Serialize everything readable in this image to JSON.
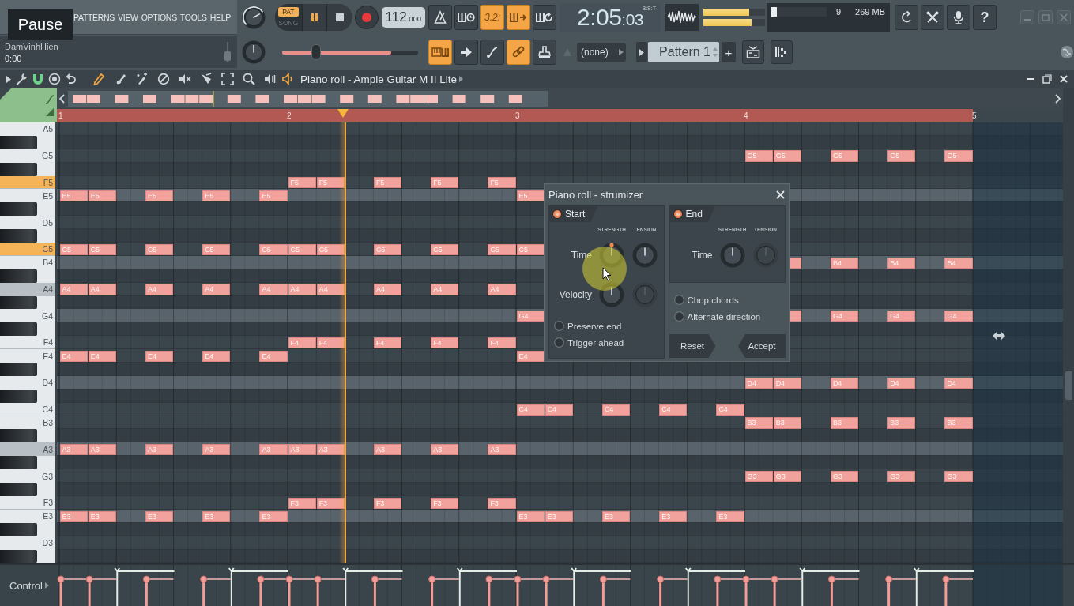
{
  "menu": {
    "items": [
      "PATTERNS",
      "VIEW",
      "OPTIONS",
      "TOOLS",
      "HELP"
    ]
  },
  "tooltip": "Pause",
  "hint_panel": {
    "title": "DamVinhHien",
    "time": "0:00"
  },
  "transport": {
    "modes": [
      {
        "label": "PAT",
        "selected": true
      },
      {
        "label": "SONG",
        "selected": false
      }
    ],
    "playing": true,
    "tempo": {
      "whole": "112",
      "fraction": ".000"
    }
  },
  "position_slider": {
    "level": 0.25
  },
  "position_bar": {
    "level": 0.8
  },
  "toolbar_top": [
    {
      "on": false
    },
    {
      "on": false
    },
    {
      "on": true,
      "text": "3.2:"
    },
    {
      "on": true
    },
    {
      "on": false
    }
  ],
  "toolbar_bottom": [
    {
      "on": true
    },
    {
      "on": false
    },
    {
      "on": false
    },
    {
      "on": true
    },
    {
      "on": false
    }
  ],
  "song_time": {
    "value": "2:05",
    "ticks": ":03",
    "format": "B:S:T"
  },
  "output_meters": [
    {
      "level": 0.74
    },
    {
      "level": 0.78
    }
  ],
  "cpu": {
    "level": 0.1,
    "polyphony": "9",
    "memory": "269 MB"
  },
  "help_button": "?",
  "channel_selector": {
    "value": "(none)"
  },
  "pattern_selector": {
    "value": "Pattern 1",
    "add": "+"
  },
  "piano_roll": {
    "title": "Piano roll - Ample Guitar M II Lite",
    "tools": [
      {
        "selected": true
      },
      {
        "selected": false
      },
      {
        "selected": false
      },
      {
        "selected": false
      },
      {
        "selected": false
      },
      {
        "selected": false
      },
      {
        "selected": false
      },
      {
        "selected": false
      },
      {
        "selected": false
      }
    ],
    "timeline": {
      "bars": [
        "1",
        "2",
        "3",
        "4",
        "5"
      ],
      "playhead": {
        "level": 0.3125
      }
    },
    "rows": [
      {
        "kind": "white",
        "key": "A5",
        "pressed": false,
        "shaded": false,
        "highlighted": false
      },
      {
        "kind": "black",
        "pressed": false,
        "shaded": false,
        "highlighted": false
      },
      {
        "kind": "white",
        "key": "G5",
        "pressed": false,
        "shaded": false,
        "highlighted": false,
        "bars": [
          {
            "kind": "empty"
          },
          {
            "kind": "empty"
          },
          {
            "kind": "empty"
          },
          {
            "kind": "notes",
            "slots": [
              {
                "kind": "note",
                "label": "G5"
              },
              {
                "kind": "note",
                "label": "G5"
              },
              {
                "kind": "rest"
              },
              {
                "kind": "note",
                "label": "G5"
              },
              {
                "kind": "rest"
              },
              {
                "kind": "note",
                "label": "G5"
              },
              {
                "kind": "rest"
              },
              {
                "kind": "note",
                "label": "G5"
              }
            ]
          }
        ]
      },
      {
        "kind": "black",
        "pressed": false,
        "shaded": false,
        "highlighted": false
      },
      {
        "kind": "white",
        "key": "F5",
        "pressed": true,
        "shaded": false,
        "highlighted": false,
        "bars": [
          {
            "kind": "empty"
          },
          {
            "kind": "notes",
            "slots": [
              {
                "kind": "note",
                "label": "F5"
              },
              {
                "kind": "note",
                "label": "F5"
              },
              {
                "kind": "rest"
              },
              {
                "kind": "note",
                "label": "F5"
              },
              {
                "kind": "rest"
              },
              {
                "kind": "note",
                "label": "F5"
              },
              {
                "kind": "rest"
              },
              {
                "kind": "note",
                "label": "F5"
              }
            ]
          }
        ]
      },
      {
        "kind": "white",
        "key": "E5",
        "pressed": false,
        "shaded": false,
        "highlighted": true,
        "bars": [
          {
            "kind": "notes",
            "slots": [
              {
                "kind": "note",
                "label": "E5"
              },
              {
                "kind": "note",
                "label": "E5"
              },
              {
                "kind": "rest"
              },
              {
                "kind": "note",
                "label": "E5"
              },
              {
                "kind": "rest"
              },
              {
                "kind": "note",
                "label": "E5"
              },
              {
                "kind": "rest"
              },
              {
                "kind": "note",
                "label": "E5"
              }
            ]
          },
          {
            "kind": "empty"
          },
          {
            "kind": "notes",
            "slots": [
              {
                "kind": "note",
                "label": "E5"
              }
            ]
          }
        ]
      },
      {
        "kind": "black",
        "pressed": false,
        "shaded": false,
        "highlighted": false
      },
      {
        "kind": "white",
        "key": "D5",
        "pressed": false,
        "shaded": false,
        "highlighted": false
      },
      {
        "kind": "black",
        "pressed": false,
        "shaded": false,
        "highlighted": false
      },
      {
        "kind": "white",
        "key": "C5",
        "pressed": true,
        "shaded": false,
        "highlighted": false,
        "bars": [
          {
            "kind": "notes",
            "slots": [
              {
                "kind": "note",
                "label": "C5"
              },
              {
                "kind": "note",
                "label": "C5"
              },
              {
                "kind": "rest"
              },
              {
                "kind": "note",
                "label": "C5"
              },
              {
                "kind": "rest"
              },
              {
                "kind": "note",
                "label": "C5"
              },
              {
                "kind": "rest"
              },
              {
                "kind": "note",
                "label": "C5"
              }
            ]
          },
          {
            "kind": "notes",
            "slots": [
              {
                "kind": "note",
                "label": "C5"
              },
              {
                "kind": "note",
                "label": "C5"
              },
              {
                "kind": "rest"
              },
              {
                "kind": "note",
                "label": "C5"
              },
              {
                "kind": "rest"
              },
              {
                "kind": "note",
                "label": "C5"
              },
              {
                "kind": "rest"
              },
              {
                "kind": "note",
                "label": "C5"
              }
            ]
          },
          {
            "kind": "notes",
            "slots": [
              {
                "kind": "note",
                "label": "C5"
              }
            ]
          }
        ]
      },
      {
        "kind": "white",
        "key": "B4",
        "pressed": false,
        "shaded": false,
        "highlighted": true,
        "bars": [
          {
            "kind": "empty"
          },
          {
            "kind": "empty"
          },
          {
            "kind": "empty"
          },
          {
            "kind": "notes",
            "slots": [
              {
                "kind": "rest"
              },
              {
                "kind": "note"
              },
              {
                "kind": "rest"
              },
              {
                "kind": "note",
                "label": "B4"
              },
              {
                "kind": "rest"
              },
              {
                "kind": "note",
                "label": "B4"
              },
              {
                "kind": "rest"
              },
              {
                "kind": "note",
                "label": "B4"
              }
            ]
          }
        ]
      },
      {
        "kind": "black",
        "pressed": false,
        "shaded": false,
        "highlighted": false
      },
      {
        "kind": "white",
        "key": "A4",
        "pressed": false,
        "shaded": true,
        "highlighted": false,
        "bars": [
          {
            "kind": "notes",
            "slots": [
              {
                "kind": "note",
                "label": "A4"
              },
              {
                "kind": "note",
                "label": "A4"
              },
              {
                "kind": "rest"
              },
              {
                "kind": "note",
                "label": "A4"
              },
              {
                "kind": "rest"
              },
              {
                "kind": "note",
                "label": "A4"
              },
              {
                "kind": "rest"
              },
              {
                "kind": "note",
                "label": "A4"
              }
            ]
          },
          {
            "kind": "notes",
            "slots": [
              {
                "kind": "note",
                "label": "A4"
              },
              {
                "kind": "note",
                "label": "A4"
              },
              {
                "kind": "rest"
              },
              {
                "kind": "note",
                "label": "A4"
              },
              {
                "kind": "rest"
              },
              {
                "kind": "note",
                "label": "A4"
              },
              {
                "kind": "rest"
              },
              {
                "kind": "note",
                "label": "A4"
              }
            ]
          }
        ]
      },
      {
        "kind": "black",
        "pressed": false,
        "shaded": false,
        "highlighted": false
      },
      {
        "kind": "white",
        "key": "G4",
        "pressed": false,
        "shaded": false,
        "highlighted": true,
        "bars": [
          {
            "kind": "empty"
          },
          {
            "kind": "empty"
          },
          {
            "kind": "notes",
            "slots": [
              {
                "kind": "note",
                "label": "G4"
              }
            ]
          },
          {
            "kind": "notes",
            "slots": [
              {
                "kind": "rest"
              },
              {
                "kind": "note"
              },
              {
                "kind": "rest"
              },
              {
                "kind": "note",
                "label": "G4"
              },
              {
                "kind": "rest"
              },
              {
                "kind": "note",
                "label": "G4"
              },
              {
                "kind": "rest"
              },
              {
                "kind": "note",
                "label": "G4"
              }
            ]
          }
        ]
      },
      {
        "kind": "black",
        "pressed": false,
        "shaded": false,
        "highlighted": false
      },
      {
        "kind": "white",
        "key": "F4",
        "pressed": false,
        "shaded": false,
        "highlighted": false,
        "bars": [
          {
            "kind": "empty"
          },
          {
            "kind": "notes",
            "slots": [
              {
                "kind": "note",
                "label": "F4"
              },
              {
                "kind": "note",
                "label": "F4"
              },
              {
                "kind": "rest"
              },
              {
                "kind": "note",
                "label": "F4"
              },
              {
                "kind": "rest"
              },
              {
                "kind": "note",
                "label": "F4"
              },
              {
                "kind": "rest"
              },
              {
                "kind": "note",
                "label": "F4"
              }
            ]
          }
        ]
      },
      {
        "kind": "white",
        "key": "E4",
        "pressed": false,
        "shaded": false,
        "highlighted": false,
        "bars": [
          {
            "kind": "notes",
            "slots": [
              {
                "kind": "note",
                "label": "E4"
              },
              {
                "kind": "note",
                "label": "E4"
              },
              {
                "kind": "rest"
              },
              {
                "kind": "note",
                "label": "E4"
              },
              {
                "kind": "rest"
              },
              {
                "kind": "note",
                "label": "E4"
              },
              {
                "kind": "rest"
              },
              {
                "kind": "note",
                "label": "E4"
              }
            ]
          },
          {
            "kind": "empty"
          },
          {
            "kind": "notes",
            "slots": [
              {
                "kind": "note",
                "label": "E4"
              }
            ]
          }
        ]
      },
      {
        "kind": "black",
        "pressed": false,
        "shaded": false,
        "highlighted": false
      },
      {
        "kind": "white",
        "key": "D4",
        "pressed": false,
        "shaded": false,
        "highlighted": true,
        "bars": [
          {
            "kind": "empty"
          },
          {
            "kind": "empty"
          },
          {
            "kind": "empty"
          },
          {
            "kind": "notes",
            "slots": [
              {
                "kind": "note",
                "label": "D4"
              },
              {
                "kind": "note",
                "label": "D4"
              },
              {
                "kind": "rest"
              },
              {
                "kind": "note",
                "label": "D4"
              },
              {
                "kind": "rest"
              },
              {
                "kind": "note",
                "label": "D4"
              },
              {
                "kind": "rest"
              },
              {
                "kind": "note",
                "label": "D4"
              }
            ]
          }
        ]
      },
      {
        "kind": "black",
        "pressed": false,
        "shaded": false,
        "highlighted": false
      },
      {
        "kind": "white",
        "key": "C4",
        "pressed": false,
        "shaded": false,
        "highlighted": false,
        "bars": [
          {
            "kind": "empty"
          },
          {
            "kind": "empty"
          },
          {
            "kind": "notes",
            "slots": [
              {
                "kind": "note",
                "label": "C4"
              },
              {
                "kind": "note",
                "label": "C4"
              },
              {
                "kind": "rest"
              },
              {
                "kind": "note",
                "label": "C4"
              },
              {
                "kind": "rest"
              },
              {
                "kind": "note",
                "label": "C4"
              },
              {
                "kind": "rest"
              },
              {
                "kind": "note",
                "label": "C4"
              }
            ]
          }
        ]
      },
      {
        "kind": "white",
        "key": "B3",
        "pressed": false,
        "shaded": false,
        "highlighted": false,
        "bars": [
          {
            "kind": "empty"
          },
          {
            "kind": "empty"
          },
          {
            "kind": "empty"
          },
          {
            "kind": "notes",
            "slots": [
              {
                "kind": "note",
                "label": "B3"
              },
              {
                "kind": "note",
                "label": "B3"
              },
              {
                "kind": "rest"
              },
              {
                "kind": "note",
                "label": "B3"
              },
              {
                "kind": "rest"
              },
              {
                "kind": "note",
                "label": "B3"
              },
              {
                "kind": "rest"
              },
              {
                "kind": "note",
                "label": "B3"
              }
            ]
          }
        ]
      },
      {
        "kind": "black",
        "pressed": false,
        "shaded": false,
        "highlighted": false
      },
      {
        "kind": "white",
        "key": "A3",
        "pressed": false,
        "shaded": true,
        "highlighted": true,
        "bars": [
          {
            "kind": "notes",
            "slots": [
              {
                "kind": "note",
                "label": "A3"
              },
              {
                "kind": "note",
                "label": "A3"
              },
              {
                "kind": "rest"
              },
              {
                "kind": "note",
                "label": "A3"
              },
              {
                "kind": "rest"
              },
              {
                "kind": "note",
                "label": "A3"
              },
              {
                "kind": "rest"
              },
              {
                "kind": "note",
                "label": "A3"
              }
            ]
          },
          {
            "kind": "notes",
            "slots": [
              {
                "kind": "note",
                "label": "A3"
              },
              {
                "kind": "note",
                "label": "A3"
              },
              {
                "kind": "rest"
              },
              {
                "kind": "note",
                "label": "A3"
              },
              {
                "kind": "rest"
              },
              {
                "kind": "note",
                "label": "A3"
              },
              {
                "kind": "rest"
              },
              {
                "kind": "note",
                "label": "A3"
              }
            ]
          }
        ]
      },
      {
        "kind": "black",
        "pressed": false,
        "shaded": false,
        "highlighted": false
      },
      {
        "kind": "white",
        "key": "G3",
        "pressed": false,
        "shaded": false,
        "highlighted": false,
        "bars": [
          {
            "kind": "empty"
          },
          {
            "kind": "empty"
          },
          {
            "kind": "empty"
          },
          {
            "kind": "notes",
            "slots": [
              {
                "kind": "note",
                "label": "G3"
              },
              {
                "kind": "note",
                "label": "G3"
              },
              {
                "kind": "rest"
              },
              {
                "kind": "note",
                "label": "G3"
              },
              {
                "kind": "rest"
              },
              {
                "kind": "note",
                "label": "G3"
              },
              {
                "kind": "rest"
              },
              {
                "kind": "note",
                "label": "G3"
              }
            ]
          }
        ]
      },
      {
        "kind": "black",
        "pressed": false,
        "shaded": false,
        "highlighted": false
      },
      {
        "kind": "white",
        "key": "F3",
        "pressed": false,
        "shaded": false,
        "highlighted": false,
        "bars": [
          {
            "kind": "empty"
          },
          {
            "kind": "notes",
            "slots": [
              {
                "kind": "note",
                "label": "F3"
              },
              {
                "kind": "note",
                "label": "F3"
              },
              {
                "kind": "rest"
              },
              {
                "kind": "note",
                "label": "F3"
              },
              {
                "kind": "rest"
              },
              {
                "kind": "note",
                "label": "F3"
              },
              {
                "kind": "rest"
              },
              {
                "kind": "note",
                "label": "F3"
              }
            ]
          }
        ]
      },
      {
        "kind": "white",
        "key": "E3",
        "pressed": false,
        "shaded": false,
        "highlighted": true,
        "bars": [
          {
            "kind": "notes",
            "slots": [
              {
                "kind": "note",
                "label": "E3"
              },
              {
                "kind": "note",
                "label": "E3"
              },
              {
                "kind": "rest"
              },
              {
                "kind": "note",
                "label": "E3"
              },
              {
                "kind": "rest"
              },
              {
                "kind": "note",
                "label": "E3"
              },
              {
                "kind": "rest"
              },
              {
                "kind": "note",
                "label": "E3"
              }
            ]
          },
          {
            "kind": "empty"
          },
          {
            "kind": "notes",
            "slots": [
              {
                "kind": "note",
                "label": "E3"
              },
              {
                "kind": "note",
                "label": "E3"
              },
              {
                "kind": "rest"
              },
              {
                "kind": "note",
                "label": "E3"
              },
              {
                "kind": "rest"
              },
              {
                "kind": "note",
                "label": "E3"
              },
              {
                "kind": "rest"
              },
              {
                "kind": "note",
                "label": "E3"
              }
            ]
          }
        ]
      },
      {
        "kind": "black",
        "pressed": false,
        "shaded": false,
        "highlighted": false
      },
      {
        "kind": "white",
        "key": "D3",
        "pressed": false,
        "shaded": false,
        "highlighted": false
      },
      {
        "kind": "black",
        "pressed": false,
        "shaded": false,
        "highlighted": false
      }
    ],
    "control": {
      "label": "Control"
    }
  },
  "strumizer": {
    "title": "Piano roll - strumizer",
    "sections": [
      {
        "label": "Start",
        "on": true,
        "headers": [
          "STRENGTH",
          "TENSION"
        ],
        "rows": [
          {
            "label": "Time",
            "knobs": [
              {
                "disabled": false,
                "focused": true
              },
              {
                "disabled": false,
                "focused": false
              }
            ]
          },
          {
            "label": "Velocity",
            "knobs": [
              {
                "disabled": false,
                "focused": false
              },
              {
                "disabled": true,
                "focused": false
              }
            ]
          }
        ]
      },
      {
        "label": "End",
        "on": true,
        "headers": [
          "STRENGTH",
          "TENSION"
        ],
        "rows": [
          {
            "label": "Time",
            "knobs": [
              {
                "disabled": false,
                "focused": false
              },
              {
                "disabled": true,
                "focused": false
              }
            ]
          }
        ]
      }
    ],
    "options_left": [
      {
        "label": "Preserve end",
        "checked": false
      },
      {
        "label": "Trigger ahead",
        "checked": false
      }
    ],
    "options_right": [
      {
        "label": "Chop chords",
        "checked": false
      },
      {
        "label": "Alternate direction",
        "checked": false
      }
    ],
    "buttons": [
      "Reset",
      "Accept"
    ]
  }
}
